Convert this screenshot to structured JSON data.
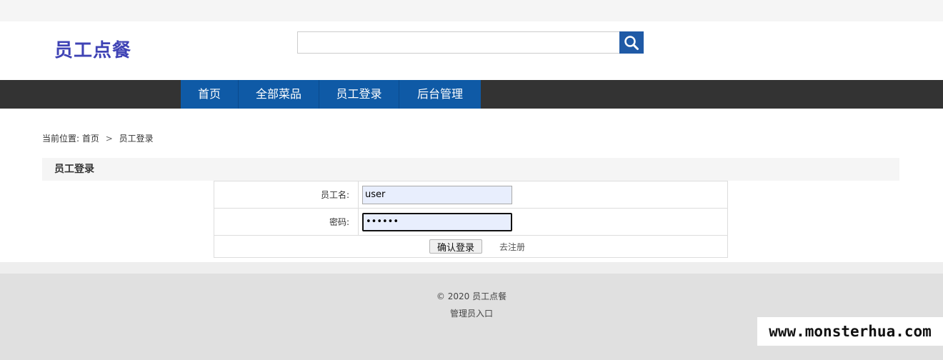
{
  "header": {
    "logo": "员工点餐",
    "search": {
      "value": "",
      "placeholder": ""
    }
  },
  "nav": {
    "items": [
      {
        "label": "首页"
      },
      {
        "label": "全部菜品"
      },
      {
        "label": "员工登录"
      },
      {
        "label": "后台管理"
      }
    ]
  },
  "breadcrumb": {
    "prefix": "当前位置:",
    "home": "首页",
    "separator": ">",
    "current": "员工登录"
  },
  "panel": {
    "title": "员工登录"
  },
  "form": {
    "username_label": "员工名:",
    "username_value": "user",
    "password_label": "密码:",
    "password_value": "••••••",
    "submit_label": "确认登录",
    "register_label": "去注册"
  },
  "footer": {
    "copyright": "© 2020 员工点餐",
    "admin_link": "管理员入口"
  },
  "watermark": "www.monsterhua.com",
  "colors": {
    "brand": "#3f43b5",
    "nav_bg": "#333333",
    "nav_active": "#0f5aa6",
    "search_button": "#1f5aa6"
  },
  "icons": {
    "search": "search-icon"
  }
}
